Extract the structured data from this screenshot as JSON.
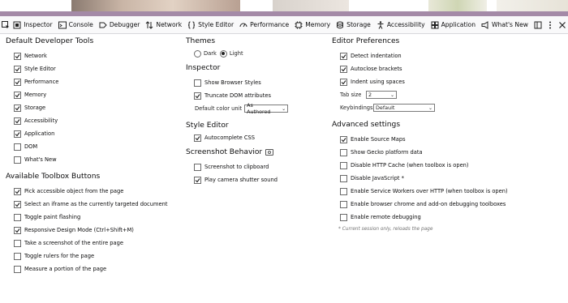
{
  "toolbar": {
    "tabs": [
      {
        "label": "Inspector",
        "icon": "inspector-icon"
      },
      {
        "label": "Console",
        "icon": "console-icon"
      },
      {
        "label": "Debugger",
        "icon": "debugger-icon"
      },
      {
        "label": "Network",
        "icon": "network-icon"
      },
      {
        "label": "Style Editor",
        "icon": "style-editor-icon"
      },
      {
        "label": "Performance",
        "icon": "performance-icon"
      },
      {
        "label": "Memory",
        "icon": "memory-icon"
      },
      {
        "label": "Storage",
        "icon": "storage-icon"
      },
      {
        "label": "Accessibility",
        "icon": "accessibility-icon"
      },
      {
        "label": "Application",
        "icon": "application-icon"
      },
      {
        "label": "What's New",
        "icon": "whats-new-icon"
      }
    ]
  },
  "default_tools": {
    "title": "Default Developer Tools",
    "items": [
      {
        "label": "Network",
        "checked": true
      },
      {
        "label": "Style Editor",
        "checked": true
      },
      {
        "label": "Performance",
        "checked": true
      },
      {
        "label": "Memory",
        "checked": true
      },
      {
        "label": "Storage",
        "checked": true
      },
      {
        "label": "Accessibility",
        "checked": true
      },
      {
        "label": "Application",
        "checked": true
      },
      {
        "label": "DOM",
        "checked": false
      },
      {
        "label": "What's New",
        "checked": false
      }
    ]
  },
  "toolbox_buttons": {
    "title": "Available Toolbox Buttons",
    "items": [
      {
        "label": "Pick accessible object from the page",
        "checked": true
      },
      {
        "label": "Select an iframe as the currently targeted document",
        "checked": true
      },
      {
        "label": "Toggle paint flashing",
        "checked": false
      },
      {
        "label": "Responsive Design Mode (Ctrl+Shift+M)",
        "checked": true
      },
      {
        "label": "Take a screenshot of the entire page",
        "checked": false
      },
      {
        "label": "Toggle rulers for the page",
        "checked": false
      },
      {
        "label": "Measure a portion of the page",
        "checked": false
      }
    ]
  },
  "themes": {
    "title": "Themes",
    "dark_label": "Dark",
    "light_label": "Light",
    "selected": "light"
  },
  "inspector": {
    "title": "Inspector",
    "show_browser_styles": {
      "label": "Show Browser Styles",
      "checked": false
    },
    "truncate_dom": {
      "label": "Truncate DOM attributes",
      "checked": true
    },
    "color_unit_label": "Default color unit",
    "color_unit_value": "As Authored"
  },
  "style_editor": {
    "title": "Style Editor",
    "autocomplete": {
      "label": "Autocomplete CSS",
      "checked": true
    }
  },
  "screenshot": {
    "title": "Screenshot Behavior",
    "items": [
      {
        "label": "Screenshot to clipboard",
        "checked": false
      },
      {
        "label": "Play camera shutter sound",
        "checked": true
      }
    ]
  },
  "editor_prefs": {
    "title": "Editor Preferences",
    "items": [
      {
        "label": "Detect indentation",
        "checked": true
      },
      {
        "label": "Autoclose brackets",
        "checked": true
      },
      {
        "label": "Indent using spaces",
        "checked": true
      }
    ],
    "tab_size_label": "Tab size",
    "tab_size_value": "2",
    "keybindings_label": "Keybindings",
    "keybindings_value": "Default"
  },
  "advanced": {
    "title": "Advanced settings",
    "items": [
      {
        "label": "Enable Source Maps",
        "checked": true
      },
      {
        "label": "Show Gecko platform data",
        "checked": false
      },
      {
        "label": "Disable HTTP Cache (when toolbox is open)",
        "checked": false
      },
      {
        "label": "Disable JavaScript *",
        "checked": false
      },
      {
        "label": "Enable Service Workers over HTTP (when toolbox is open)",
        "checked": false
      },
      {
        "label": "Enable browser chrome and add-on debugging toolboxes",
        "checked": false
      },
      {
        "label": "Enable remote debugging",
        "checked": false
      }
    ],
    "note": "* Current session only, reloads the page"
  },
  "colors": {
    "accent_bar": "#a48aa7",
    "toolbar_bg": "#f9f9fa"
  }
}
